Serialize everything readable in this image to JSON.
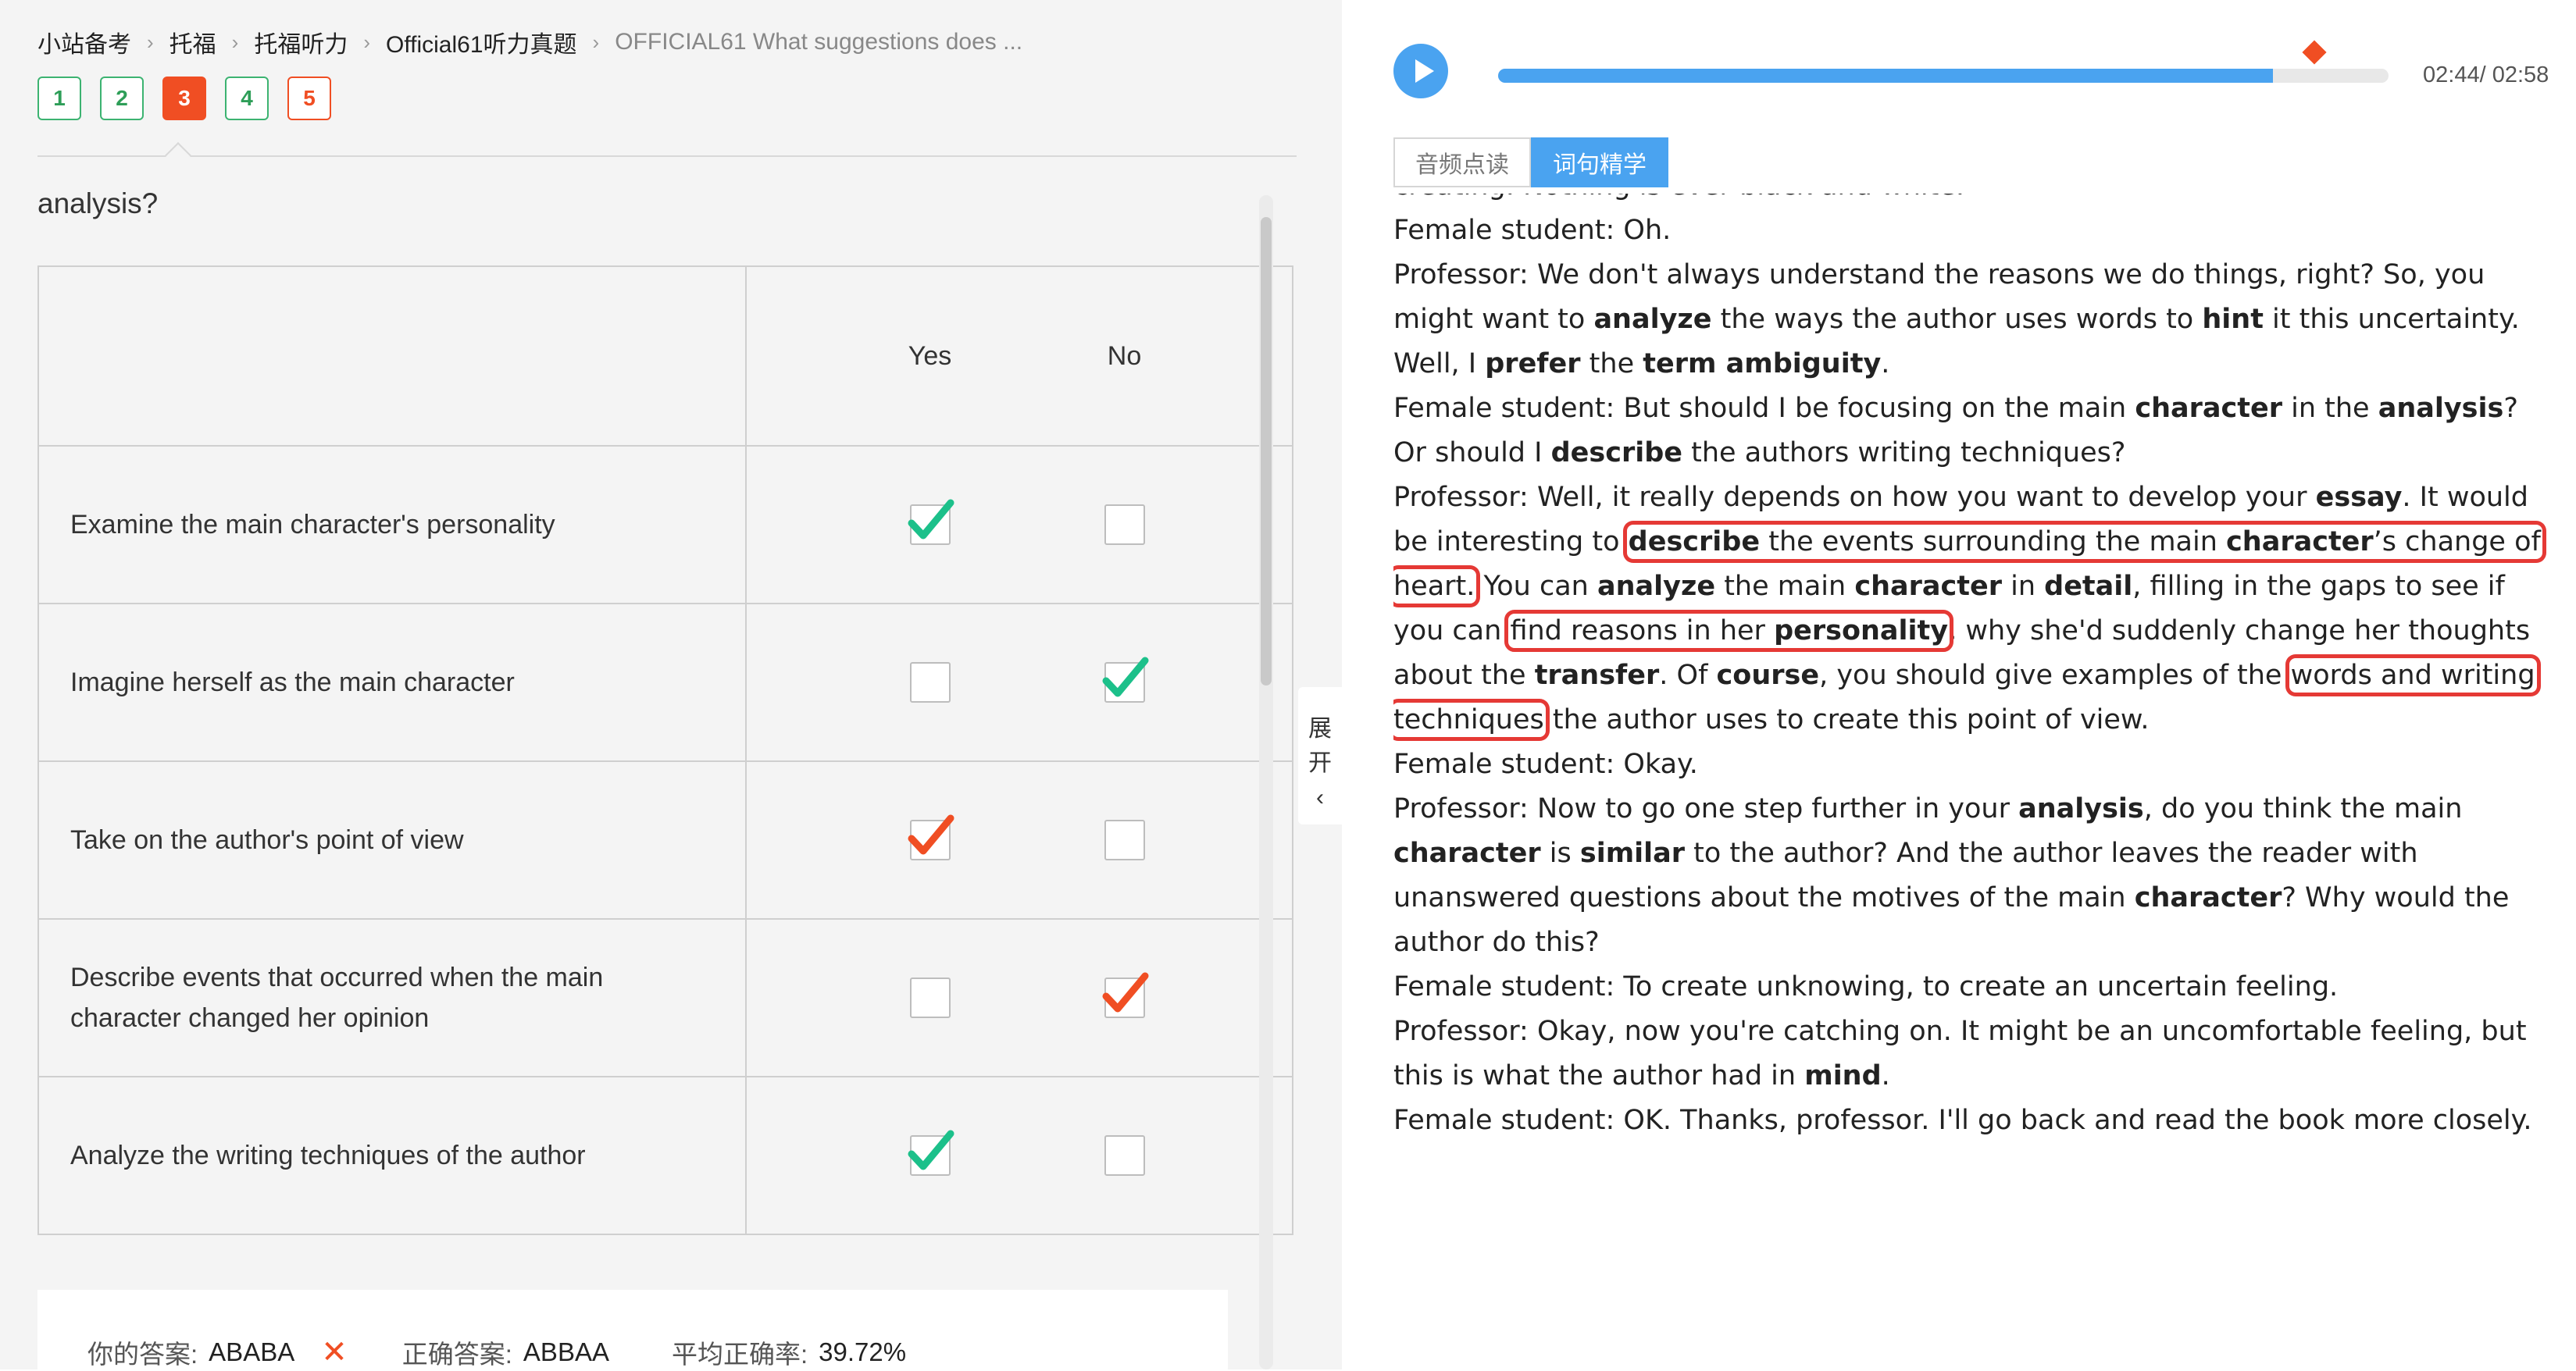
{
  "breadcrumb": [
    {
      "label": "小站备考"
    },
    {
      "label": "托福"
    },
    {
      "label": "托福听力"
    },
    {
      "label": "Official61听力真题"
    },
    {
      "label": "OFFICIAL61 What suggestions does ..."
    }
  ],
  "question_numbers": [
    {
      "label": "1",
      "state": "correct"
    },
    {
      "label": "2",
      "state": "correct"
    },
    {
      "label": "3",
      "state": "active"
    },
    {
      "label": "4",
      "state": "correct"
    },
    {
      "label": "5",
      "state": "wrong"
    }
  ],
  "question": {
    "text": "analysis?"
  },
  "table": {
    "headers": {
      "yes": "Yes",
      "no": "No"
    },
    "rows": [
      {
        "statement": "Examine the main character's personality",
        "checked": "yes",
        "status": "correct"
      },
      {
        "statement": "Imagine herself as the main character",
        "checked": "no",
        "status": "correct"
      },
      {
        "statement": "Take on the author's point of view",
        "checked": "yes",
        "status": "wrong"
      },
      {
        "statement": "Describe events that occurred when the main character changed her opinion",
        "checked": "no",
        "status": "wrong"
      },
      {
        "statement": "Analyze the writing techniques of the author",
        "checked": "yes",
        "status": "correct"
      }
    ]
  },
  "answer": {
    "your_label": "你的答案:",
    "your_value": "ABABA",
    "wrong_mark": "✕",
    "correct_label": "正确答案:",
    "correct_value": "ABBAA",
    "avg_label": "平均正确率:",
    "avg_value": "39.72%"
  },
  "expand": {
    "char1": "展",
    "char2": "开",
    "arrow": "‹"
  },
  "player": {
    "current": "02:44",
    "total": "/ 02:58",
    "progress_fraction": 0.87,
    "marker_fraction": 0.87
  },
  "tabs": [
    {
      "label": "音频点读",
      "active": false
    },
    {
      "label": "词句精学",
      "active": true
    }
  ],
  "colors": {
    "accent": "#4aa3f0",
    "wrong": "#f04e23",
    "correct": "#1cc08a",
    "highlight": "#e53935"
  },
  "transcript": {
    "l0": "creating. Nothing is ever black and white.",
    "l1": "Female student: Oh.",
    "l2a": "Professor: We don't always understand the reasons we do things, right? So, you might want to ",
    "l2b": "analyze",
    "l2c": " the ways the author uses words to ",
    "l2d": "hint",
    "l2e": " it this uncertainty. Well, I ",
    "l2f": "prefer",
    "l2g": " the ",
    "l2h": "term ambiguity",
    "l2i": ".",
    "l3a": "Female student: But should I be focusing on the main ",
    "l3b": "character",
    "l3c": " in the ",
    "l3d": "analysis",
    "l3e": "? Or should I ",
    "l3f": "describe",
    "l3g": " the authors writing techniques?",
    "l4a": "Professor: Well, it really depends on how you want to develop your ",
    "l4b": "essay",
    "l4c": ". It would be interesting to ",
    "h1a": "describe",
    "h1b": " the events surrounding the main ",
    "h1c": "character",
    "h1d": "’s change of heart.",
    "l4d": " You can ",
    "l4e": "analyze",
    "l4f": " the main ",
    "l4g": "character",
    "l4h": " in ",
    "l4i": "detail",
    "l4j": ", filling in the gaps to see if you can ",
    "h2a": "find reasons in her ",
    "h2b": "personality",
    "l4k": ", why she'd suddenly change her thoughts about the ",
    "l4l": "transfer",
    "l4m": ". Of ",
    "l4n": "course",
    "l4o": ", you should give examples of the ",
    "h3a": "words and writing techniques",
    "l4p": " the author uses to create this point of view.",
    "l5": "Female student: Okay.",
    "l6a": "Professor: Now to go one step further in your ",
    "l6b": "analysis",
    "l6c": ", do you think the main ",
    "l6d": "character",
    "l6e": " is ",
    "l6f": "similar",
    "l6g": " to the author? And the author leaves the reader with unanswered questions about the motives of the main ",
    "l6h": "character",
    "l6i": "? Why would the author do this?",
    "l7": "Female student: To create unknowing, to create an uncertain feeling.",
    "l8a": "Professor: Okay, now you're catching on. It might be an uncomfortable feeling, but this is what the author had in ",
    "l8b": "mind",
    "l8c": ".",
    "l9": "Female student: OK. Thanks, professor. I'll go back and read the book more closely."
  }
}
